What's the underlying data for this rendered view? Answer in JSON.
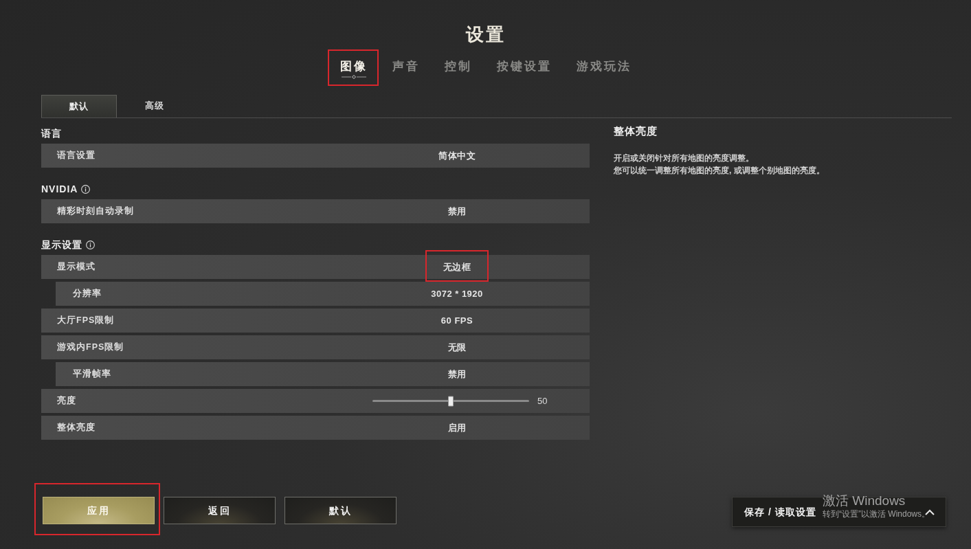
{
  "title": "设置",
  "tabs": [
    {
      "label": "图像",
      "selected": true,
      "highlighted": true
    },
    {
      "label": "声音",
      "selected": false,
      "highlighted": false
    },
    {
      "label": "控制",
      "selected": false,
      "highlighted": false
    },
    {
      "label": "按键设置",
      "selected": false,
      "highlighted": false
    },
    {
      "label": "游戏玩法",
      "selected": false,
      "highlighted": false
    }
  ],
  "subtabs": [
    {
      "label": "默认",
      "selected": true
    },
    {
      "label": "高级",
      "selected": false
    }
  ],
  "sections": [
    {
      "heading": "语言",
      "info": false,
      "rows": [
        {
          "kind": "option",
          "label": "语言设置",
          "value": "简体中文",
          "highlighted": false
        }
      ]
    },
    {
      "heading": "NVIDIA",
      "info": true,
      "rows": [
        {
          "kind": "option",
          "label": "精彩时刻自动录制",
          "value": "禁用",
          "highlighted": false
        }
      ]
    },
    {
      "heading": "显示设置",
      "info": true,
      "rows": [
        {
          "kind": "option",
          "label": "显示模式",
          "value": "无边框",
          "highlighted": true,
          "children": [
            {
              "kind": "option",
              "label": "分辨率",
              "value": "3072 * 1920",
              "highlighted": false
            }
          ]
        },
        {
          "kind": "option",
          "label": "大厅FPS限制",
          "value": "60 FPS",
          "highlighted": false
        },
        {
          "kind": "option",
          "label": "游戏内FPS限制",
          "value": "无限",
          "highlighted": false,
          "children": [
            {
              "kind": "option",
              "label": "平滑帧率",
              "value": "禁用",
              "highlighted": false
            }
          ]
        },
        {
          "kind": "slider",
          "label": "亮度",
          "level": 0.5,
          "reading": "50"
        },
        {
          "kind": "option",
          "label": "整体亮度",
          "value": "启用",
          "highlighted": false
        }
      ]
    }
  ],
  "detail": {
    "title": "整体亮度",
    "lines": [
      "开启或关闭针对所有地图的亮度调整。",
      "您可以统一调整所有地图的亮度, 或调整个别地图的亮度。"
    ]
  },
  "buttons": [
    {
      "label": "应用",
      "primary": true,
      "highlighted": true
    },
    {
      "label": "返回",
      "primary": false,
      "highlighted": false
    },
    {
      "label": "默认",
      "primary": false,
      "highlighted": false
    }
  ],
  "save_load_button": {
    "label": "保存 / 读取设置"
  },
  "os_notice": {
    "title": "激活 Windows",
    "text": "转到“设置”以激活 Windows。"
  }
}
